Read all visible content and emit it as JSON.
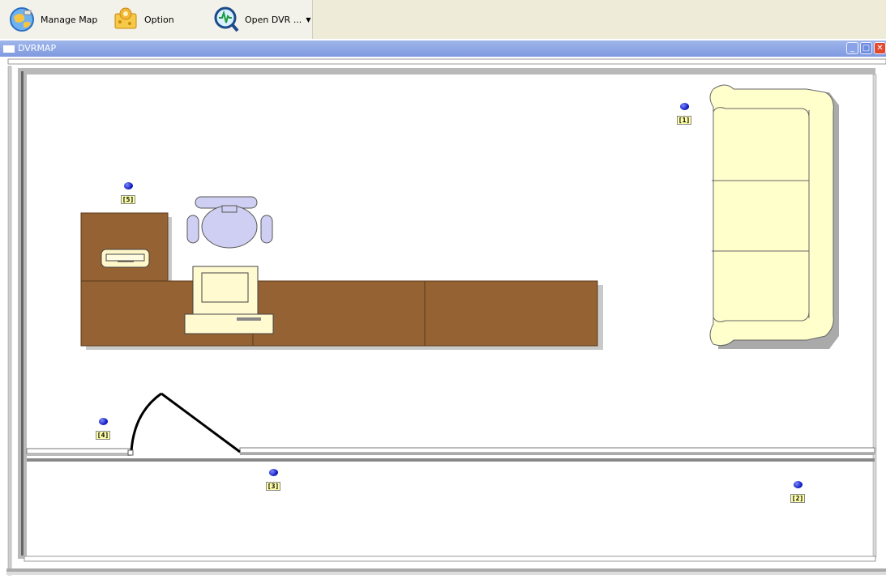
{
  "toolbar": {
    "manage_map": "Manage Map",
    "option": "Option",
    "open_dvr": "Open DVR ..."
  },
  "window": {
    "title": "DVRMAP"
  },
  "cameras": [
    {
      "label": "[1]"
    },
    {
      "label": "[2]"
    },
    {
      "label": "[3]"
    },
    {
      "label": "[4]"
    },
    {
      "label": "[5]"
    }
  ],
  "colors": {
    "desk": "#956234",
    "sofa": "#ffffcc",
    "chair": "#cfcff3",
    "monitor": "#fffad0",
    "titlebar": "#7f9adf",
    "camera": "#0a12b8"
  }
}
